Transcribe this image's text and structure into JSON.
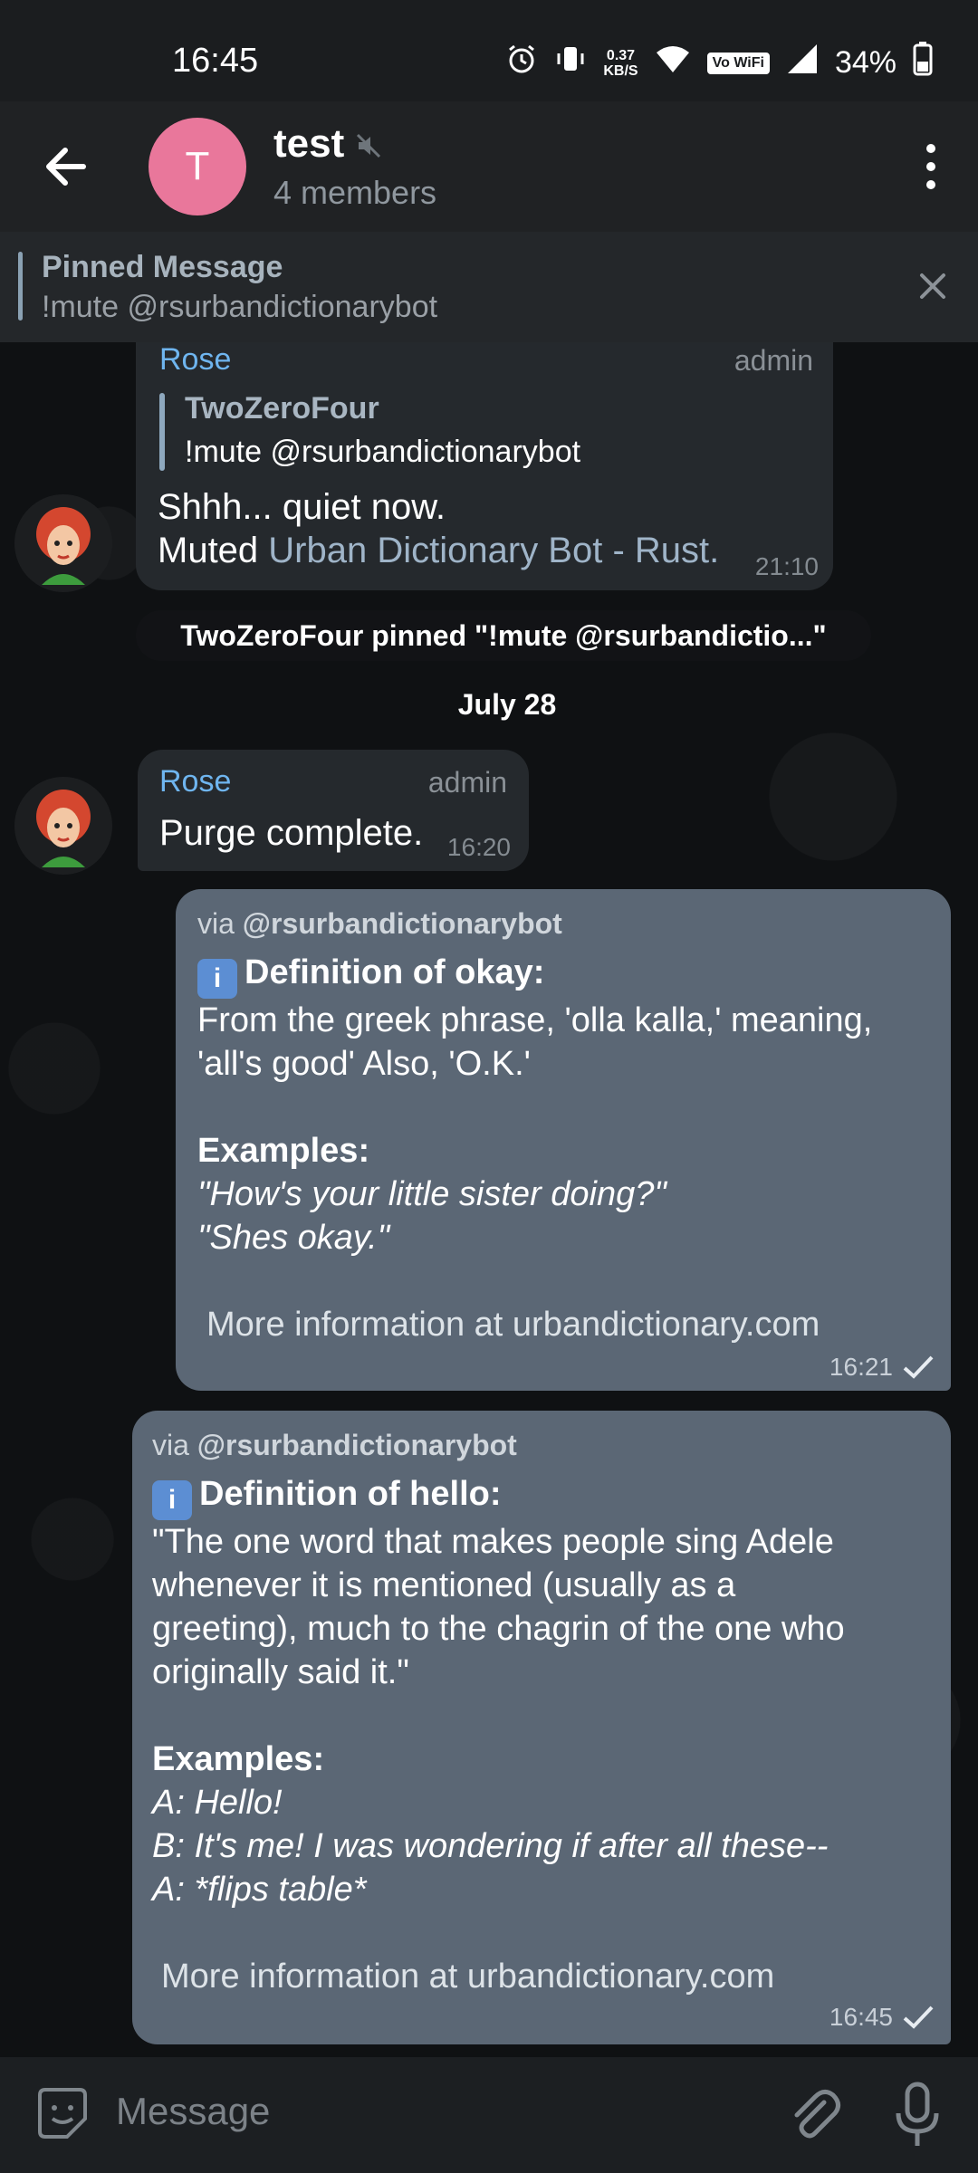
{
  "status_bar": {
    "time": "16:45",
    "net_speed_value": "0.37",
    "net_speed_unit": "KB/S",
    "volte_label": "Vo WiFi",
    "battery": "34%"
  },
  "header": {
    "avatar_letter": "T",
    "title": "test",
    "subtitle": "4 members"
  },
  "pinned": {
    "title": "Pinned Message",
    "text": "!mute @rsurbandictionarybot"
  },
  "messages": {
    "m1": {
      "sender": "Rose",
      "role": "admin",
      "reply_author": "TwoZeroFour",
      "reply_text": "!mute @rsurbandictionarybot",
      "line1": "Shhh... quiet now.",
      "line2_prefix": "Muted",
      "line2_link": "Urban Dictionary Bot - Rust.",
      "time": "21:10"
    },
    "system_pin": "TwoZeroFour pinned \"!mute @rsurbandictio...\"",
    "date_divider": "July 28",
    "m2": {
      "sender": "Rose",
      "role": "admin",
      "text": "Purge complete.",
      "time": "16:20"
    },
    "m3": {
      "via_prefix": "via",
      "via_bot": "@rsurbandictionarybot",
      "info_icon": "i",
      "heading": "Definition of okay:",
      "definition_line1": "From the greek phrase, 'olla kalla,' meaning,",
      "definition_line2": "'all's good' Also, 'O.K.'",
      "examples_label": "Examples:",
      "example_line1": "\"How's your little sister doing?\"",
      "example_line2": "\"Shes okay.\"",
      "more_info": "More information at urbandictionary.com",
      "time": "16:21"
    },
    "m4": {
      "via_prefix": "via",
      "via_bot": "@rsurbandictionarybot",
      "info_icon": "i",
      "heading": "Definition of hello:",
      "definition_line1": "\"The one word that makes people sing Adele",
      "definition_line2": "whenever it is mentioned (usually as a",
      "definition_line3": "greeting), much to the chagrin of the one who",
      "definition_line4": "originally said it.\"",
      "examples_label": "Examples:",
      "example_line1": "A: Hello!",
      "example_line2": "B: It's me! I was wondering if after all these--",
      "example_line3": "A: *flips table*",
      "more_info": "More information at urbandictionary.com",
      "time": "16:45"
    }
  },
  "composer": {
    "placeholder": "Message"
  },
  "colors": {
    "incoming_bubble": "#25292d",
    "outgoing_bubble": "#5b6775",
    "sender_name": "#6fb5ef",
    "header_bg": "#202224",
    "avatar_bg": "#e9779b"
  },
  "icons": [
    "alarm-icon",
    "vibrate-icon",
    "wifi-icon",
    "signal-icon",
    "battery-icon",
    "back-arrow-icon",
    "muted-speaker-icon",
    "more-vert-icon",
    "close-icon",
    "sticker-icon",
    "paperclip-icon",
    "microphone-icon",
    "check-icon",
    "info-icon"
  ]
}
